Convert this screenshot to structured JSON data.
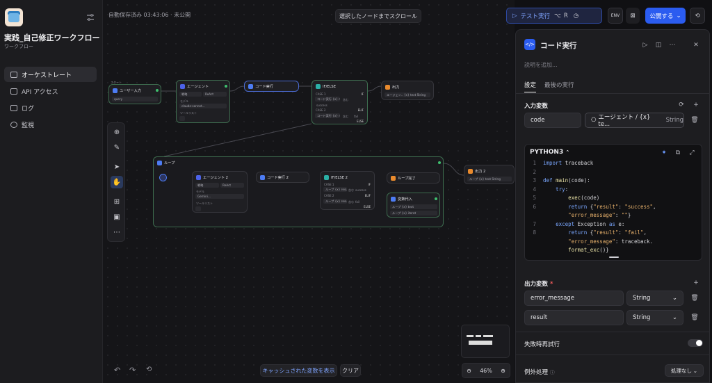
{
  "app": {
    "title": "実践_自己修正ワークフロー",
    "subtitle": "ワークフロー",
    "nav": [
      {
        "label": "オーケストレート",
        "icon": "orchestrate-icon"
      },
      {
        "label": "API アクセス",
        "icon": "terminal-icon"
      },
      {
        "label": "ログ",
        "icon": "document-icon"
      },
      {
        "label": "監視",
        "icon": "monitor-icon"
      }
    ]
  },
  "canvas": {
    "status": "自動保存済み 03:43:06 · 未公開",
    "scroll_button": "選択したノードまでスクロール",
    "cached_vars_button": "キャッシュされた変数を表示",
    "clear_button": "クリア",
    "zoom": "46%"
  },
  "nodes": {
    "start_caption": "スタート",
    "user_input": {
      "title": "ユーザー入力",
      "field": "query"
    },
    "agent": {
      "title": "エージェント",
      "tag1": "戦略",
      "tag2": "ReAct",
      "model_label": "モデル",
      "model": "claude-sonnet...",
      "tools_label": "ツールリスト"
    },
    "code": {
      "title": "コード実行"
    },
    "ifelse": {
      "title": "IF/ELSE",
      "case1": "CASE 1",
      "if": "IF",
      "cond1": "コード実行 {x} result",
      "op1": "含む",
      "val1": "success",
      "case2": "CASE 2",
      "elif": "ELIF",
      "cond2": "コード実行 {x} result",
      "op2": "含む",
      "val2": "fail",
      "else": "ELSE"
    },
    "output": {
      "title": "出力",
      "field": "エージェン.. {x} text String"
    },
    "loop": {
      "title": "ループ"
    },
    "agent2": {
      "title": "エージェント 2",
      "tag1": "戦略",
      "tag2": "ReAct",
      "model_label": "モデル",
      "model": "Gemini...",
      "tools_label": "ツールリスト"
    },
    "code2": {
      "title": "コード実行 2"
    },
    "ifelse2": {
      "title": "IF/ELSE 2",
      "case1": "CASE 1",
      "if": "IF",
      "cond1": "ループ {x} result",
      "op1": "含む",
      "val1": "success",
      "case2": "CASE 2",
      "elif": "ELIF",
      "cond2": "ループ {x} result",
      "op2": "含む",
      "val2": "fail",
      "else": "ELSE"
    },
    "loop_end": {
      "title": "ループ完了"
    },
    "var_assign": {
      "title": "変数代入",
      "row1": "ループ {x} text",
      "row2": "ループ {x} iterat"
    },
    "output2": {
      "title": "出力 2",
      "field": "ループ {x} text String"
    }
  },
  "header_actions": {
    "test_run": "テスト実行",
    "shortcut1": "⌥",
    "shortcut2": "R",
    "publish": "公開する"
  },
  "panel": {
    "title": "コード実行",
    "description_placeholder": "説明を追加...",
    "tabs": [
      "設定",
      "最後の実行"
    ],
    "input_vars_label": "入力変数",
    "input_var_name": "code",
    "input_var_source": "エージェント / {x} te...",
    "input_var_type": "String",
    "language": "PYTHON3",
    "code_lines": [
      "import traceback",
      "",
      "def main(code):",
      "    try:",
      "        exec(code)",
      "        return {\"result\": \"success\",",
      "        \"error_message\": \"\"}",
      "    except Exception as e:",
      "        return {\"result\": \"fail\",",
      "        \"error_message\": traceback.",
      "        format_exc()}"
    ],
    "line_numbers": [
      "1",
      "2",
      "3",
      "4",
      "5",
      "6",
      "",
      "7",
      "8",
      "",
      ""
    ],
    "output_vars_label": "出力変数",
    "required_mark": "*",
    "outputs": [
      {
        "name": "error_message",
        "type": "String"
      },
      {
        "name": "result",
        "type": "String"
      }
    ],
    "retry_label": "失敗時再試行",
    "retry_enabled": false,
    "exception_label": "例外処理",
    "exception_value": "処理なし"
  },
  "colors": {
    "accent": "#2b5cf0",
    "success": "#3fbf6e"
  }
}
